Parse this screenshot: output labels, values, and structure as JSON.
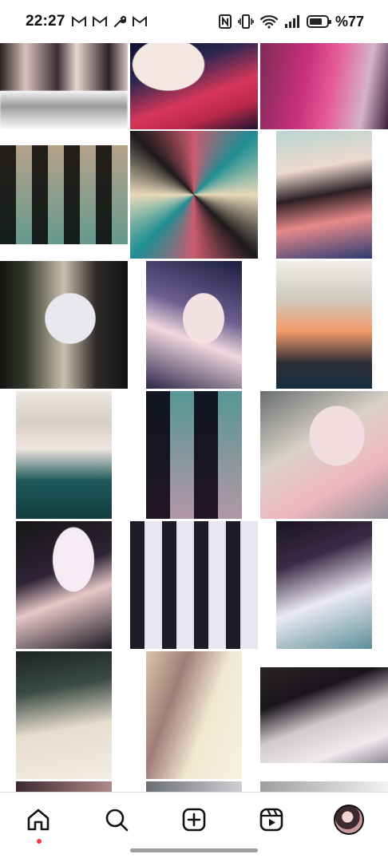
{
  "status_bar": {
    "time": "22:27",
    "left_icons": [
      "gmail-icon",
      "gmail-icon",
      "wrench-icon",
      "gmail-icon"
    ],
    "right_icons": [
      "nfc-icon",
      "vibrate-icon",
      "wifi-icon",
      "signal-icon"
    ],
    "battery_percent": "%77",
    "battery_level": 0.77
  },
  "grid": {
    "tiles": [
      {
        "name": "tile-1-1",
        "kind": "duo selfie collage"
      },
      {
        "name": "tile-1-2",
        "kind": "selfie"
      },
      {
        "name": "tile-1-3",
        "kind": "selfie"
      },
      {
        "name": "tile-2-1",
        "kind": "mirrored collage"
      },
      {
        "name": "tile-2-2",
        "kind": "mirrored collage"
      },
      {
        "name": "tile-2-3",
        "kind": "selfie"
      },
      {
        "name": "tile-3-1",
        "kind": "duo photo"
      },
      {
        "name": "tile-3-2",
        "kind": "selfie"
      },
      {
        "name": "tile-3-3",
        "kind": "selfie"
      },
      {
        "name": "tile-4-1",
        "kind": "mirror selfie"
      },
      {
        "name": "tile-4-2",
        "kind": "collage"
      },
      {
        "name": "tile-4-3",
        "kind": "selfie"
      },
      {
        "name": "tile-5-1",
        "kind": "selfie"
      },
      {
        "name": "tile-5-2",
        "kind": "repeated collage"
      },
      {
        "name": "tile-5-3",
        "kind": "selfie"
      },
      {
        "name": "tile-6-1",
        "kind": "selfie"
      },
      {
        "name": "tile-6-2",
        "kind": "selfie"
      },
      {
        "name": "tile-6-3",
        "kind": "selfie"
      }
    ]
  },
  "bottom_nav": {
    "items": [
      {
        "name": "nav-home",
        "icon": "home-icon",
        "active": true
      },
      {
        "name": "nav-search",
        "icon": "search-icon"
      },
      {
        "name": "nav-create",
        "icon": "plus-square-icon"
      },
      {
        "name": "nav-reels",
        "icon": "reels-icon"
      },
      {
        "name": "nav-profile",
        "icon": "avatar"
      }
    ]
  },
  "colors": {
    "accent_dot": "#ff3040",
    "icon": "#111111",
    "divider": "#dbdbdb"
  }
}
